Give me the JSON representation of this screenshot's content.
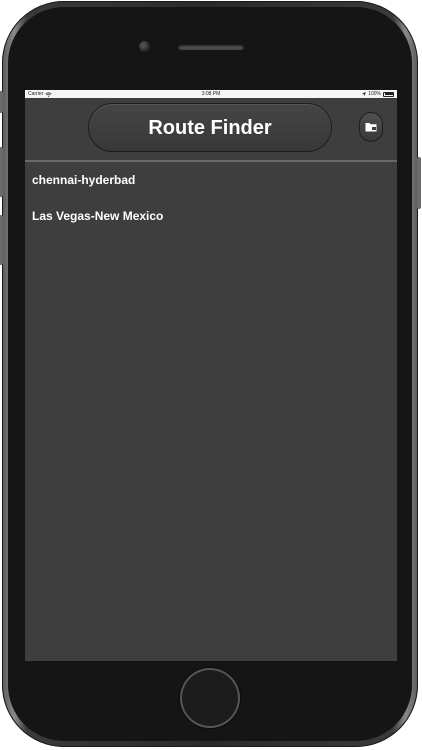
{
  "status_bar": {
    "carrier": "Carrier",
    "time": "3:08 PM",
    "battery": "100%",
    "wifi_icon": "wifi-icon",
    "location_icon": "location-arrow-icon",
    "battery_icon": "battery-icon"
  },
  "header": {
    "title": "Route Finder",
    "folder_icon": "folder-icon"
  },
  "routes": [
    {
      "label": "chennai-hyderbad"
    },
    {
      "label": "Las Vegas-New Mexico"
    }
  ],
  "colors": {
    "background": "#3e3e3e",
    "text": "#ffffff",
    "divider": "#6a6a6a"
  }
}
